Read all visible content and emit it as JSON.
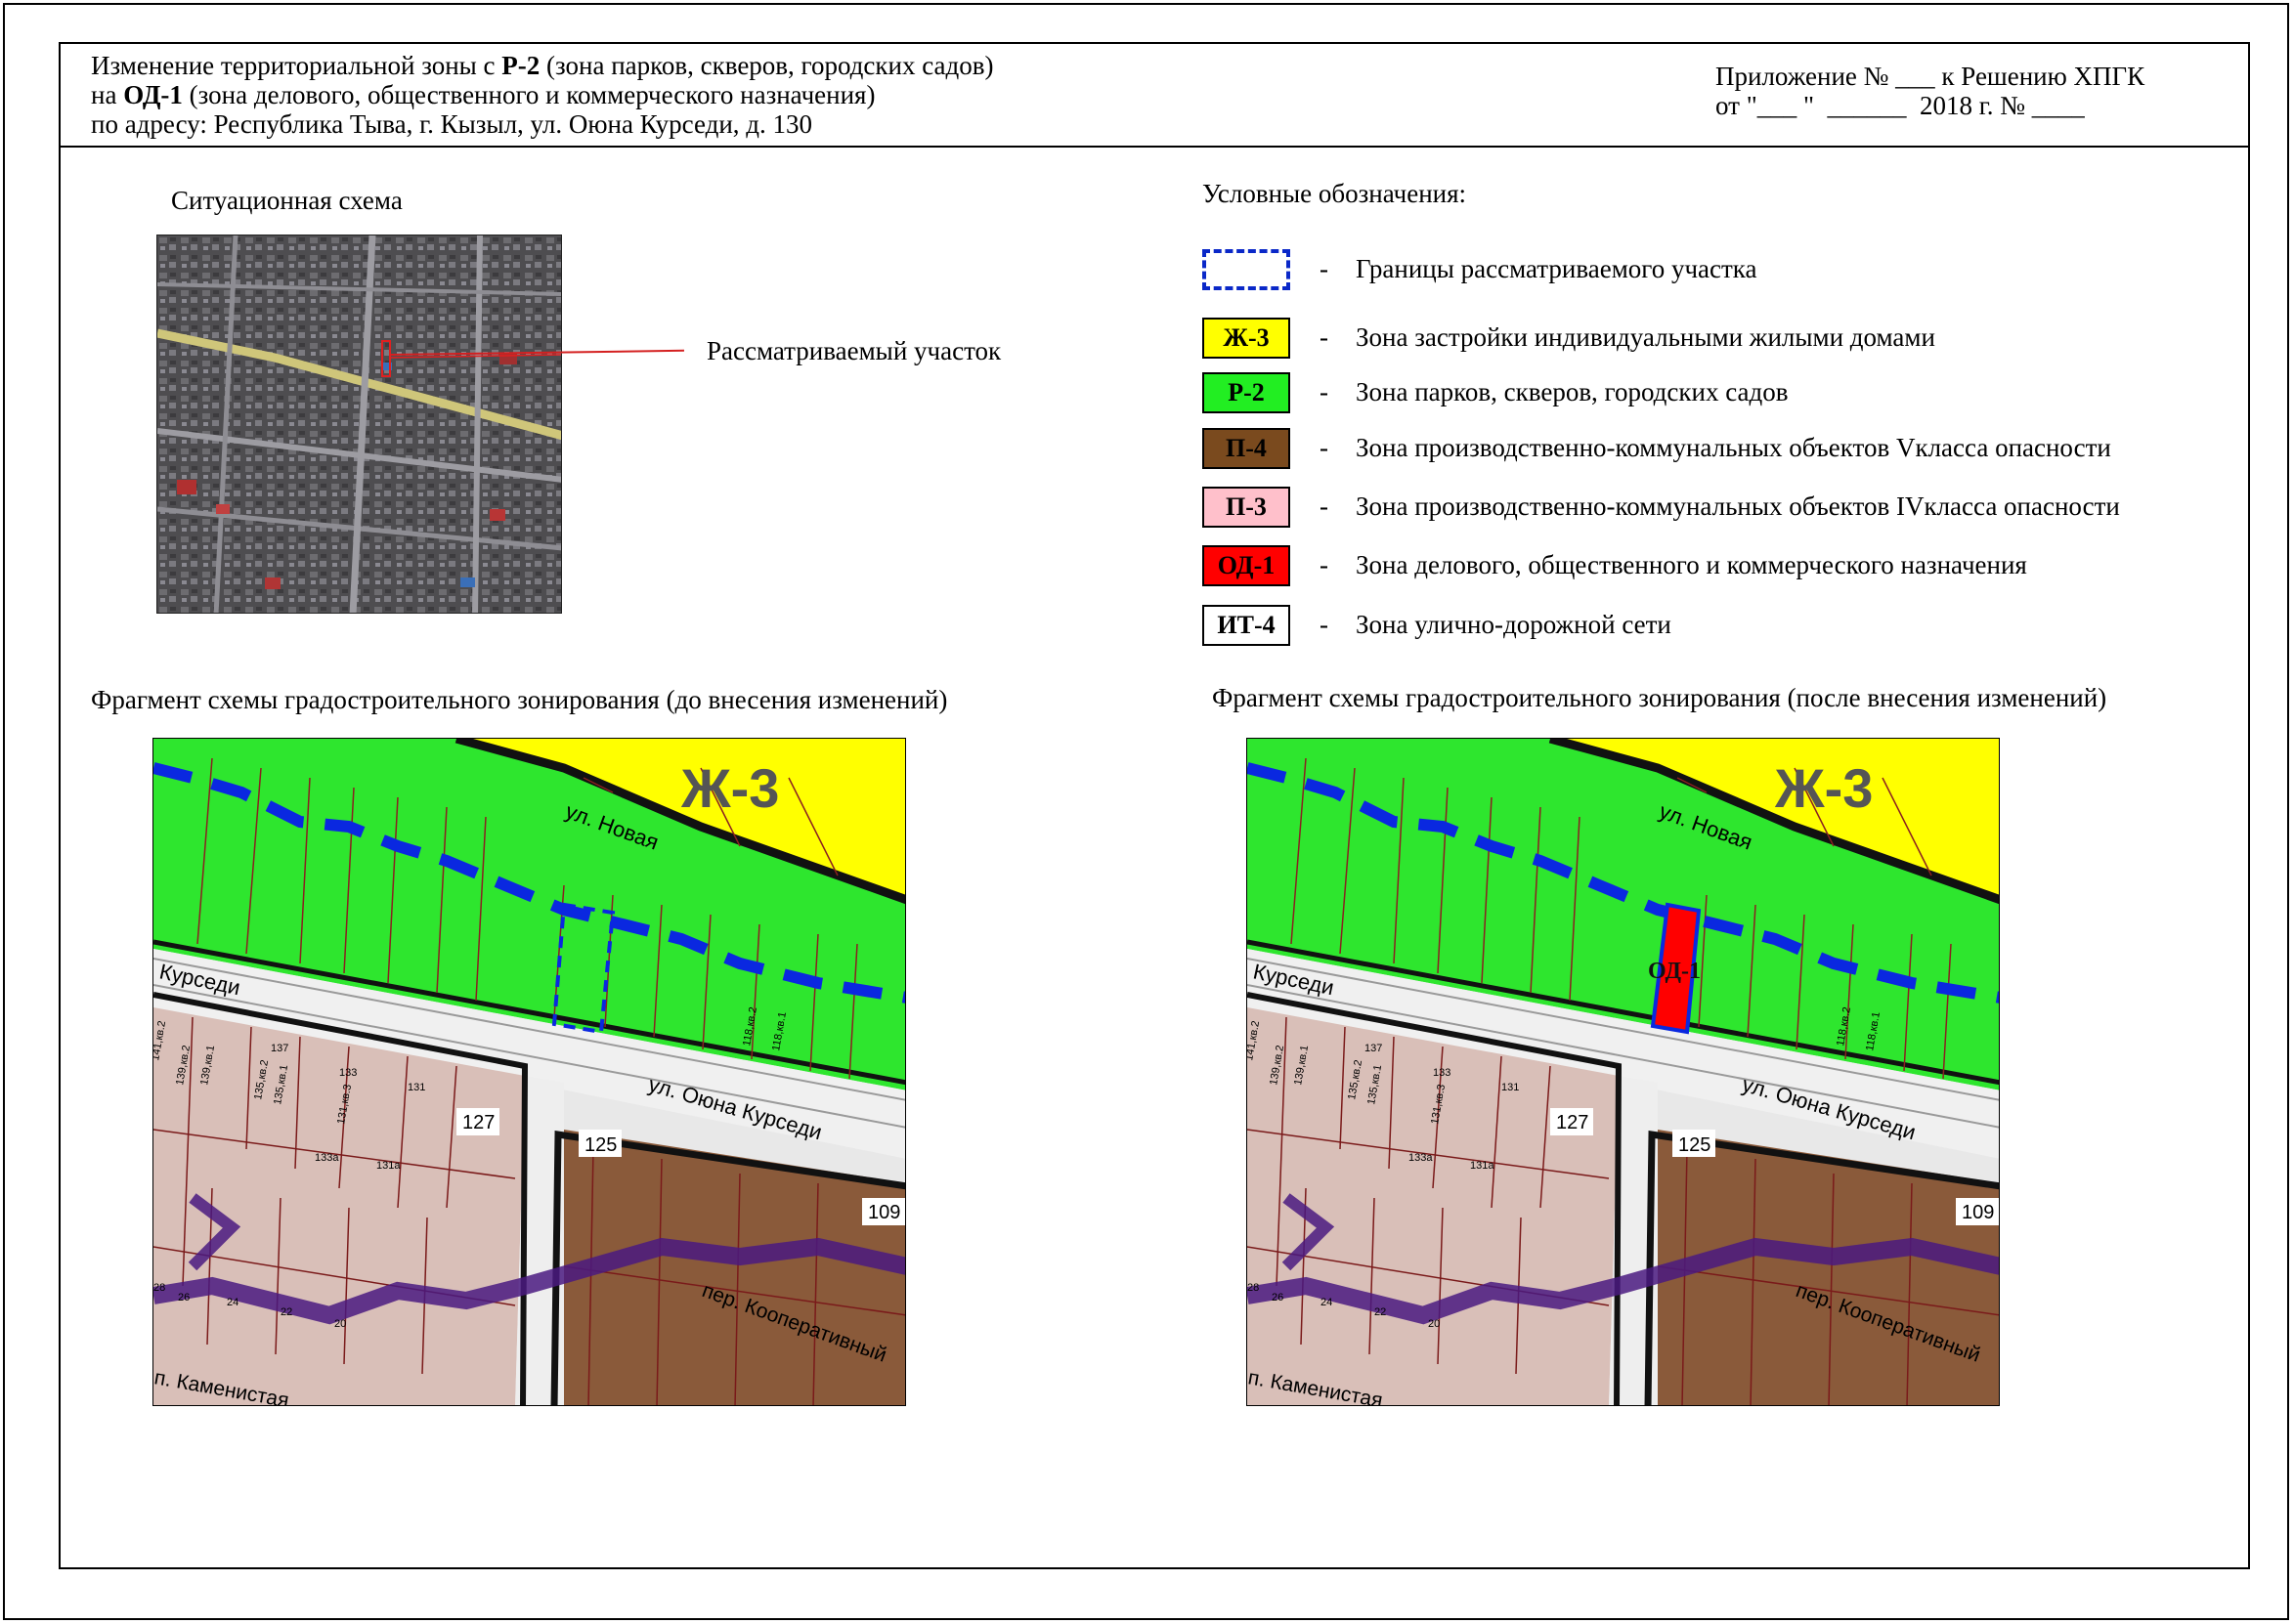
{
  "header": {
    "line1_prefix": "Изменение территориальной зоны с ",
    "line1_code": "Р-2",
    "line1_suffix": " (зона парков, скверов, городских садов)",
    "line2_prefix": "на ",
    "line2_code": "ОД-1",
    "line2_suffix": " (зона делового, общественного и коммерческого назначения)",
    "line3": "по адресу: Республика Тыва, г. Кызыл, ул. Оюна Курседи, д. 130",
    "appendix_line1": "Приложение № ___ к Решению ХПГК",
    "appendix_line2": "от \"___ \"  ______  2018 г. № ____"
  },
  "situation": {
    "title": "Ситуационная схема",
    "callout": "Рассматриваемый участок"
  },
  "legend": {
    "title": "Условные обозначения:",
    "separator": "-",
    "items": [
      {
        "code": "",
        "color": "#ffffff",
        "text": "Границы рассматриваемого участка",
        "style": "dashed-border"
      },
      {
        "code": "Ж-3",
        "color": "#ffff00",
        "text": "Зона застройки индивидуальными жилыми домами"
      },
      {
        "code": "Р-2",
        "color": "#22ee22",
        "text": "Зона парков, скверов, городских садов"
      },
      {
        "code": "П-4",
        "color": "#7a4a1e",
        "text": "Зона производственно-коммунальных объектов Vкласса опасности"
      },
      {
        "code": "П-3",
        "color": "#ffc0cb",
        "text": "Зона производственно-коммунальных объектов IVкласса опасности"
      },
      {
        "code": "ОД-1",
        "color": "#ff0000",
        "text": "Зона делового, общественного и коммерческого назначения"
      },
      {
        "code": "ИТ-4",
        "color": "#ffffff",
        "text": "Зона улично-дорожной сети"
      }
    ]
  },
  "fragments": {
    "before_title": "Фрагмент схемы градостроительного зонирования (до внесения изменений)",
    "after_title": "Фрагмент схемы градостроительного зонирования (после внесения изменений)"
  },
  "map_labels": {
    "zone_zh3": "Ж-3",
    "street_novaya": "ул. Новая",
    "street_kursedi_short": "Курседи",
    "street_kursedi": "ул. Оюна Курседи",
    "street_kooperativny": "пер. Кооперативный",
    "street_kamenistaya": "п. Каменистая",
    "od1_label": "ОД-1",
    "lots": [
      "125",
      "127",
      "109"
    ],
    "small_lots": [
      "137",
      "133",
      "131",
      "133а",
      "131а",
      "26",
      "24",
      "22",
      "20",
      "28"
    ],
    "rotated_lots": [
      "139,кв.2",
      "139,кв.1",
      "135,кв.2",
      "135,кв.1",
      "131,кв.3",
      "118,кв.2",
      "118,кв.1",
      "141,кв.2"
    ]
  }
}
